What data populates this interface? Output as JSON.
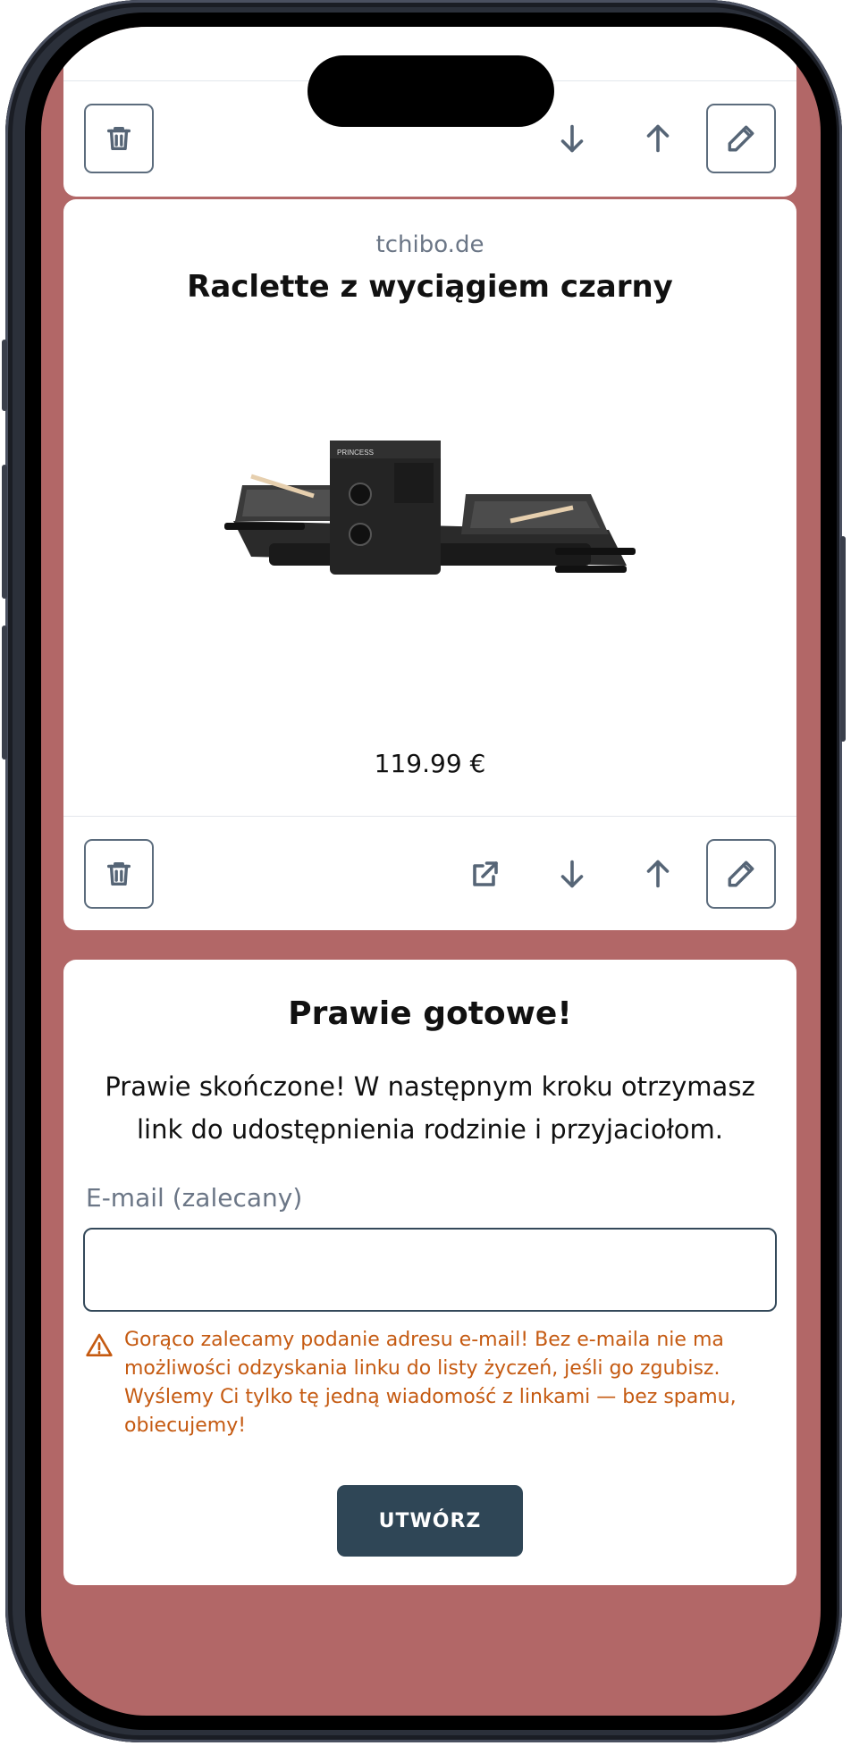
{
  "product": {
    "domain": "tchibo.de",
    "title": "Raclette z wyciągiem czarny",
    "image_label": "PRINCESS",
    "price": "119.99 €"
  },
  "form": {
    "title": "Prawie gotowe!",
    "description": "Prawie skończone! W następnym kroku otrzymasz link do udostępnienia rodzinie i przyjaciołom.",
    "email_label": "E-mail (zalecany)",
    "email_value": "",
    "warning": "Gorąco zalecamy podanie adresu e-mail! Bez e-maila nie ma możliwości odzyskania linku do listy życzeń, jeśli go zgubisz. Wyślemy Ci tylko tę jedną wiadomość z linkami — bez spamu, obiecujemy!",
    "submit_label": "UTWÓRZ"
  },
  "colors": {
    "page_background": "#b26767",
    "card_background": "#ffffff",
    "button_primary": "#2f4656",
    "warning": "#c55a11",
    "icon": "#566576"
  },
  "icons": {
    "delete": "trash-icon",
    "open": "external-link-icon",
    "move_down": "arrow-down-icon",
    "move_up": "arrow-up-icon",
    "edit": "pencil-icon",
    "warning": "warning-triangle-icon"
  }
}
